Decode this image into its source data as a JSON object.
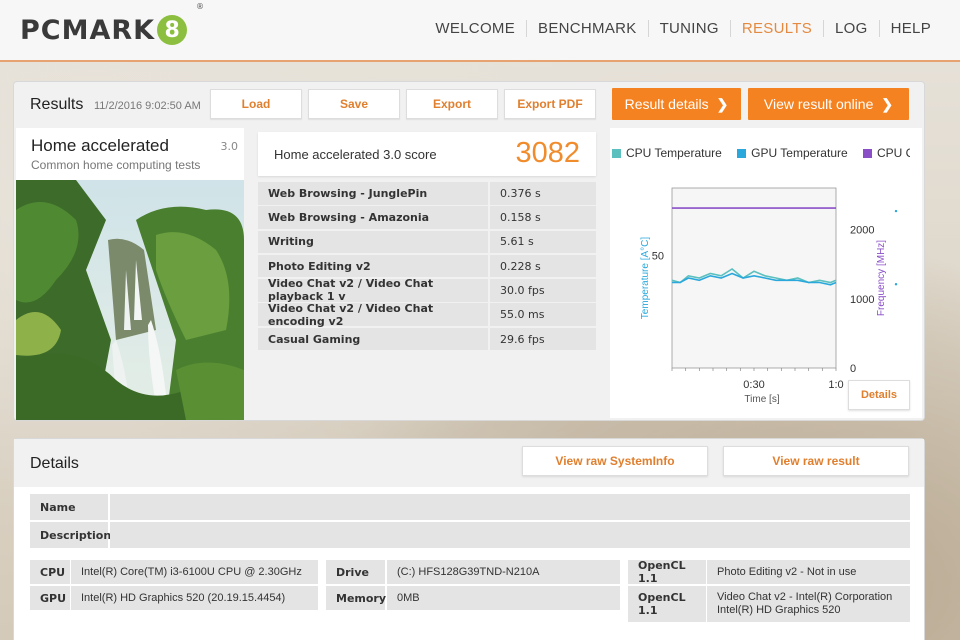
{
  "app": {
    "logo_text": "PCMARK",
    "logo_badge": "8",
    "logo_reg": "®"
  },
  "nav": {
    "items": [
      {
        "label": "WELCOME",
        "active": false
      },
      {
        "label": "BENCHMARK",
        "active": false
      },
      {
        "label": "TUNING",
        "active": false
      },
      {
        "label": "RESULTS",
        "active": true
      },
      {
        "label": "LOG",
        "active": false
      },
      {
        "label": "HELP",
        "active": false
      }
    ]
  },
  "results": {
    "title": "Results",
    "date": "11/2/2016 9:02:50 AM",
    "buttons": {
      "load": "Load",
      "save": "Save",
      "export": "Export",
      "export_pdf": "Export PDF",
      "result_details": "Result details",
      "view_online": "View result online"
    },
    "test": {
      "name": "Home accelerated",
      "version": "3.0",
      "description": "Common home computing tests"
    },
    "score": {
      "label": "Home accelerated 3.0 score",
      "value": "3082"
    },
    "subtests": [
      {
        "name": "Web Browsing - JunglePin",
        "value": "0.376 s"
      },
      {
        "name": "Web Browsing - Amazonia",
        "value": "0.158 s"
      },
      {
        "name": "Writing",
        "value": "5.61 s"
      },
      {
        "name": "Photo Editing v2",
        "value": "0.228 s"
      },
      {
        "name": "Video Chat v2 / Video Chat playback 1 v",
        "value": "30.0 fps"
      },
      {
        "name": "Video Chat v2 / Video Chat encoding v2",
        "value": "55.0 ms"
      },
      {
        "name": "Casual Gaming",
        "value": "29.6 fps"
      }
    ],
    "details_button": "Details"
  },
  "chart_data": {
    "type": "line",
    "legend": [
      {
        "name": "CPU Temperature",
        "color": "#5bc0be"
      },
      {
        "name": "GPU Temperature",
        "color": "#2aa8dc"
      },
      {
        "name": "CPU Cl",
        "color": "#8a4fc7"
      }
    ],
    "xlabel": "Time [s]",
    "ylabel_left": "Temperature [A°C]",
    "ylabel_right": "Frequency [MHz]",
    "x_ticks": [
      "0:30",
      "1:0"
    ],
    "y_left_ticks": [
      "50"
    ],
    "y_right_ticks": [
      "2000",
      "1000",
      "0"
    ],
    "x_range": [
      0,
      60
    ],
    "y_left_range": [
      0,
      80
    ],
    "y_right_range": [
      0,
      2600
    ],
    "series": [
      {
        "name": "CPU Temperature",
        "axis": "left",
        "x": [
          0,
          3,
          6,
          10,
          14,
          18,
          22,
          26,
          30,
          34,
          38,
          42,
          46,
          50,
          54,
          58,
          60
        ],
        "values": [
          39,
          38,
          41,
          40,
          42,
          41,
          44,
          40,
          43,
          41,
          40,
          39,
          40,
          38,
          39,
          38,
          39
        ]
      },
      {
        "name": "GPU Temperature",
        "axis": "left",
        "x": [
          0,
          3,
          6,
          10,
          14,
          18,
          22,
          26,
          30,
          34,
          38,
          42,
          46,
          50,
          54,
          58,
          60
        ],
        "values": [
          38,
          38,
          40,
          39,
          41,
          40,
          42,
          40,
          41,
          40,
          39,
          39,
          39,
          38,
          38,
          37,
          38
        ]
      },
      {
        "name": "CPU Cl",
        "axis": "right",
        "x": [
          0,
          60
        ],
        "values": [
          2310,
          2310
        ]
      }
    ]
  },
  "details": {
    "title": "Details",
    "view_sysinfo": "View raw SystemInfo",
    "view_raw_result": "View raw result",
    "name_key": "Name",
    "description_key": "Description",
    "hardware": {
      "cpu_key": "CPU",
      "cpu_val": "Intel(R) Core(TM) i3-6100U CPU @ 2.30GHz",
      "gpu_key": "GPU",
      "gpu_val": "Intel(R) HD Graphics 520 (20.19.15.4454)",
      "drive_key": "Drive",
      "drive_val": "(C:) HFS128G39TND-N210A",
      "memory_key": "Memory",
      "memory_val": "0MB",
      "opencl1_key": "OpenCL 1.1",
      "opencl1_val": "Photo Editing v2 - Not in use",
      "opencl2_key": "OpenCL 1.1",
      "opencl2_val_line1": "Video Chat v2 - Intel(R) Corporation",
      "opencl2_val_line2": "Intel(R) HD Graphics 520"
    }
  }
}
